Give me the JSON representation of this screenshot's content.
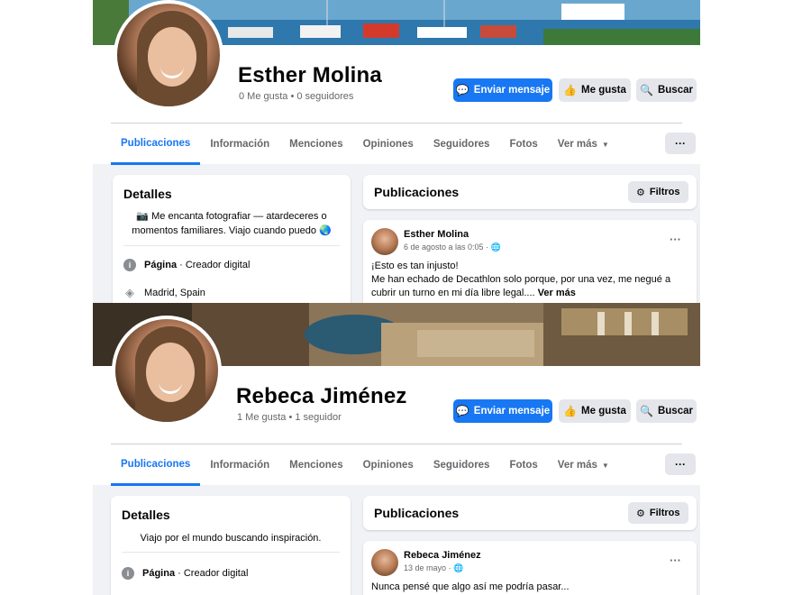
{
  "profiles": [
    {
      "name": "Esther Molina",
      "stats": "0 Me gusta • 0 seguidores",
      "buttons": {
        "message": "Enviar mensaje",
        "like": "Me gusta",
        "search": "Buscar"
      },
      "tabs": [
        "Publicaciones",
        "Información",
        "Menciones",
        "Opiniones",
        "Seguidores",
        "Fotos",
        "Ver más"
      ],
      "active_tab": "Publicaciones",
      "more_button": "···",
      "details": {
        "title": "Detalles",
        "bio_line1": "📷 Me encanta fotografiar — atardeceres o",
        "bio_line2": "momentos familiares. Viajo cuando puedo 🌏",
        "page_label": "Página",
        "page_category": " · Creador digital",
        "location": "Madrid, Spain"
      },
      "posts_card": {
        "title": "Publicaciones",
        "filters": "Filtros",
        "post": {
          "author": "Esther Molina",
          "date": "6 de agosto a las 0:05 · 🌐",
          "line1": "¡Esto es tan injusto!",
          "line2": "Me han echado de Decathlon solo porque, por una vez, me negué a",
          "line3": "cubrir un turno en mi día libre legal....",
          "see_more": "Ver más",
          "menu": "···"
        }
      }
    },
    {
      "name": "Rebeca Jiménez",
      "stats": "1 Me gusta • 1 seguidor",
      "buttons": {
        "message": "Enviar mensaje",
        "like": "Me gusta",
        "search": "Buscar"
      },
      "tabs": [
        "Publicaciones",
        "Información",
        "Menciones",
        "Opiniones",
        "Seguidores",
        "Fotos",
        "Ver más"
      ],
      "active_tab": "Publicaciones",
      "more_button": "···",
      "details": {
        "title": "Detalles",
        "bio_line1": "Viajo por el mundo buscando inspiración.",
        "page_label": "Página",
        "page_category": " · Creador digital"
      },
      "posts_card": {
        "title": "Publicaciones",
        "filters": "Filtros",
        "post": {
          "author": "Rebeca Jiménez",
          "date": "13 de mayo · 🌐",
          "line1": "Nunca pensé que algo así me podría pasar...",
          "menu": "···"
        }
      }
    }
  ],
  "icons": {
    "messenger": "messenger-icon",
    "like": "thumbs-up-icon",
    "search": "search-icon",
    "dropdown": "caret-down-icon",
    "filters": "sliders-icon",
    "info": "info-icon",
    "location": "location-pin-icon"
  },
  "colors": {
    "primary": "#1877f2",
    "background": "#f0f2f5",
    "secondary_button": "#e4e6eb",
    "muted_text": "#65676b"
  }
}
